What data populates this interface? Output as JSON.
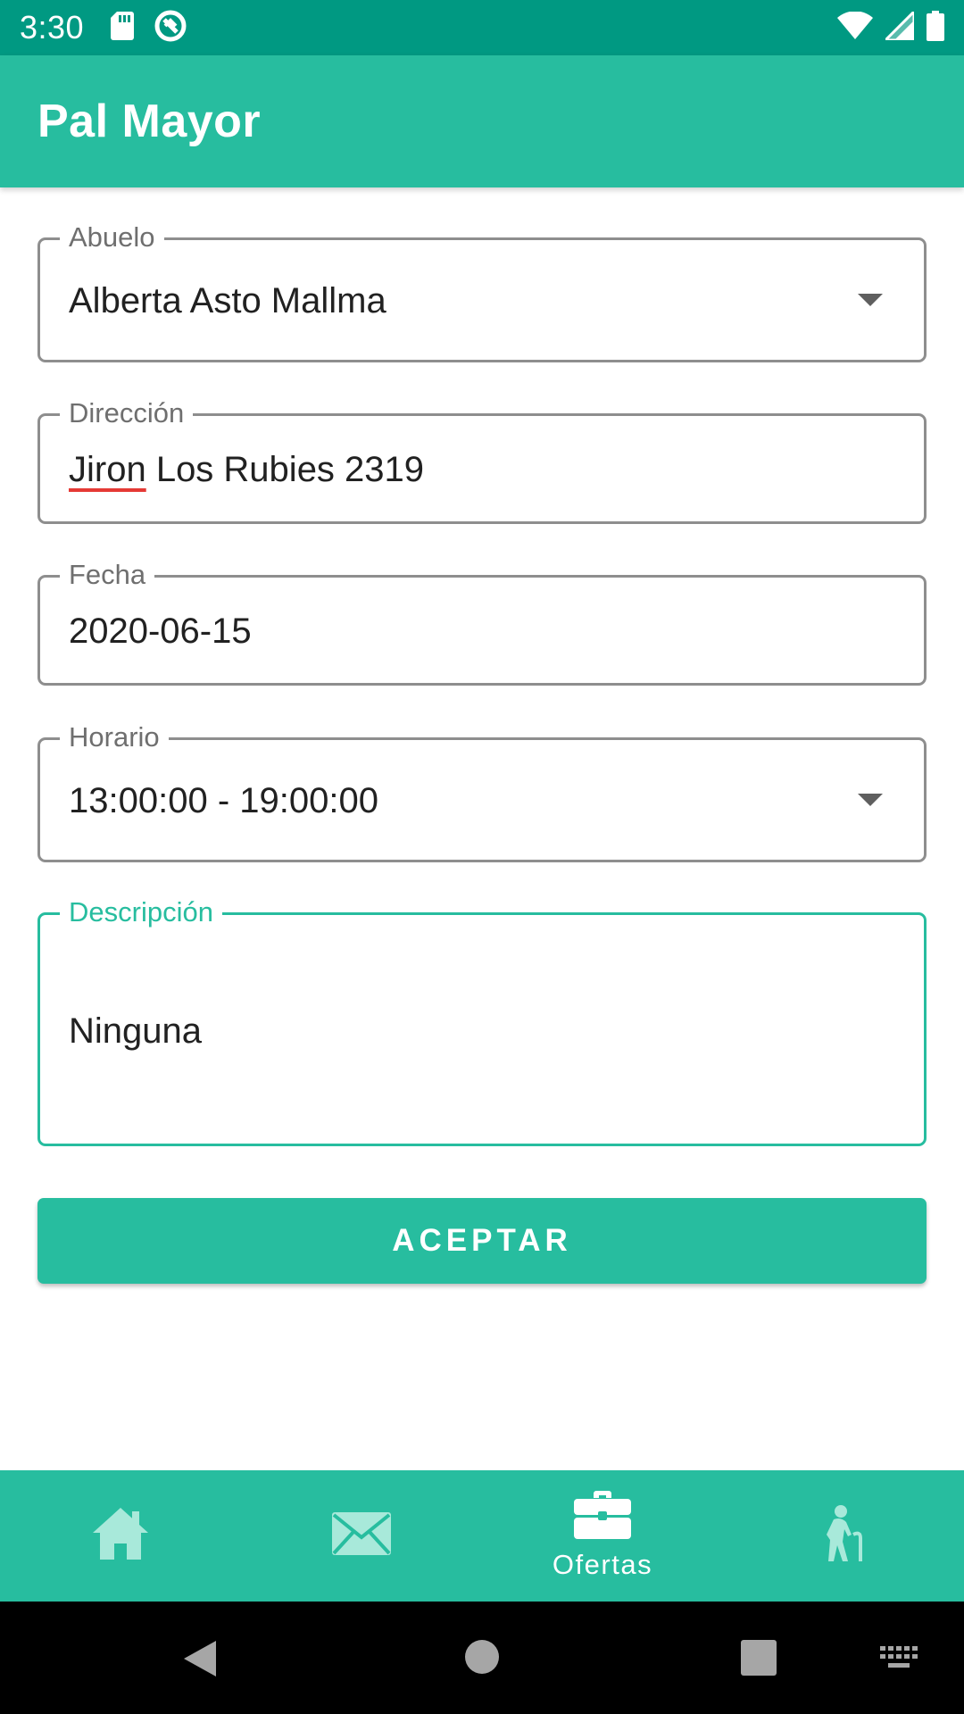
{
  "status_bar": {
    "time": "3:30",
    "left_icons": [
      "sd-card-icon",
      "sync-disabled-icon"
    ],
    "right_icons": [
      "wifi-icon",
      "cell-signal-icon",
      "battery-icon"
    ]
  },
  "app_bar": {
    "title": "Pal Mayor"
  },
  "form": {
    "abuelo": {
      "label": "Abuelo",
      "value": "Alberta Asto Mallma"
    },
    "direccion": {
      "label": "Dirección",
      "value_first_word": "Jiron",
      "value_rest": " Los Rubies 2319"
    },
    "fecha": {
      "label": "Fecha",
      "value": "2020-06-15"
    },
    "horario": {
      "label": "Horario",
      "value": "13:00:00 - 19:00:00"
    },
    "descripcion": {
      "label": "Descripción",
      "value": "Ninguna"
    },
    "accept_label": "ACEPTAR"
  },
  "bottom_nav": {
    "items": [
      {
        "icon": "home-icon",
        "label": ""
      },
      {
        "icon": "mail-icon",
        "label": ""
      },
      {
        "icon": "briefcase-icon",
        "label": "Ofertas",
        "active": true
      },
      {
        "icon": "elderly-icon",
        "label": ""
      }
    ]
  },
  "system_nav": {
    "buttons": [
      "back-icon",
      "home-circle-icon",
      "recents-icon",
      "keyboard-icon"
    ]
  },
  "colors": {
    "primary": "#27bd9f",
    "primary_dark": "#009982",
    "border": "#8e8e8e",
    "text": "#212121",
    "inactive_icon": "#a8e9da"
  }
}
